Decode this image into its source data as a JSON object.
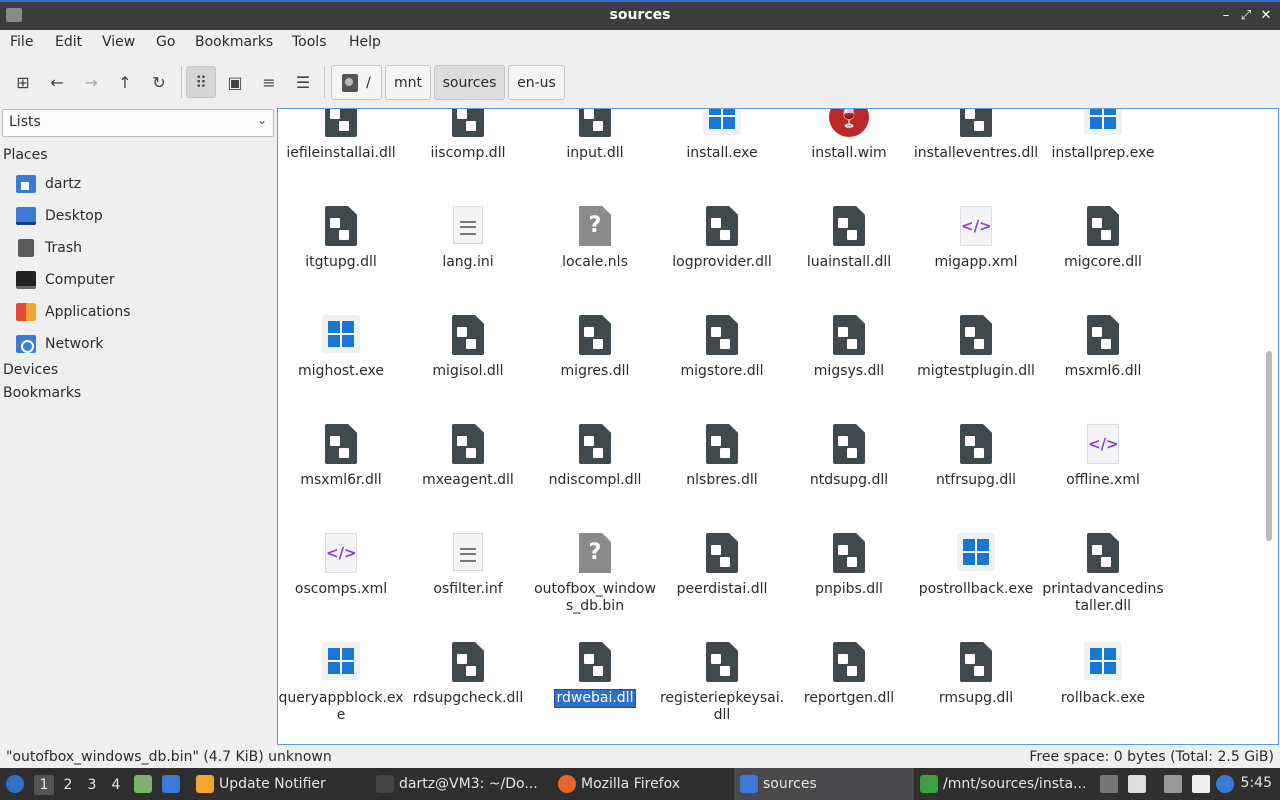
{
  "window": {
    "title": "sources"
  },
  "menu": [
    "File",
    "Edit",
    "View",
    "Go",
    "Bookmarks",
    "Tools",
    "Help"
  ],
  "path": {
    "root": "/",
    "segments": [
      "mnt",
      "sources",
      "en-us"
    ],
    "active": "sources"
  },
  "side": {
    "view_select": "Lists",
    "places_heading": "Places",
    "places": [
      {
        "label": "dartz",
        "icon": "home-folder-icon"
      },
      {
        "label": "Desktop",
        "icon": "desktop-icon"
      },
      {
        "label": "Trash",
        "icon": "trash-icon"
      },
      {
        "label": "Computer",
        "icon": "computer-icon"
      },
      {
        "label": "Applications",
        "icon": "applications-icon"
      },
      {
        "label": "Network",
        "icon": "network-icon"
      }
    ],
    "devices_heading": "Devices",
    "bookmarks_heading": "Bookmarks"
  },
  "files": [
    {
      "name": "iefileinstallai.dll",
      "type": "dll"
    },
    {
      "name": "iiscomp.dll",
      "type": "dll"
    },
    {
      "name": "input.dll",
      "type": "dll"
    },
    {
      "name": "install.exe",
      "type": "exe"
    },
    {
      "name": "install.wim",
      "type": "wim"
    },
    {
      "name": "installeventres.dll",
      "type": "dll"
    },
    {
      "name": "installprep.exe",
      "type": "exe"
    },
    {
      "name": "itgtupg.dll",
      "type": "dll"
    },
    {
      "name": "lang.ini",
      "type": "txt"
    },
    {
      "name": "locale.nls",
      "type": "unk"
    },
    {
      "name": "logprovider.dll",
      "type": "dll"
    },
    {
      "name": "luainstall.dll",
      "type": "dll"
    },
    {
      "name": "migapp.xml",
      "type": "xml"
    },
    {
      "name": "migcore.dll",
      "type": "dll"
    },
    {
      "name": "mighost.exe",
      "type": "exe"
    },
    {
      "name": "migisol.dll",
      "type": "dll"
    },
    {
      "name": "migres.dll",
      "type": "dll"
    },
    {
      "name": "migstore.dll",
      "type": "dll"
    },
    {
      "name": "migsys.dll",
      "type": "dll"
    },
    {
      "name": "migtestplugin.dll",
      "type": "dll"
    },
    {
      "name": "msxml6.dll",
      "type": "dll"
    },
    {
      "name": "msxml6r.dll",
      "type": "dll"
    },
    {
      "name": "mxeagent.dll",
      "type": "dll"
    },
    {
      "name": "ndiscompl.dll",
      "type": "dll"
    },
    {
      "name": "nlsbres.dll",
      "type": "dll"
    },
    {
      "name": "ntdsupg.dll",
      "type": "dll"
    },
    {
      "name": "ntfrsupg.dll",
      "type": "dll"
    },
    {
      "name": "offline.xml",
      "type": "xml"
    },
    {
      "name": "oscomps.xml",
      "type": "xml"
    },
    {
      "name": "osfilter.inf",
      "type": "txt"
    },
    {
      "name": "outofbox_windows_db.bin",
      "type": "unk"
    },
    {
      "name": "peerdistai.dll",
      "type": "dll"
    },
    {
      "name": "pnpibs.dll",
      "type": "dll"
    },
    {
      "name": "postrollback.exe",
      "type": "exe"
    },
    {
      "name": "printadvancedinstaller.dll",
      "type": "dll"
    },
    {
      "name": "queryappblock.exe",
      "type": "exe"
    },
    {
      "name": "rdsupgcheck.dll",
      "type": "dll"
    },
    {
      "name": "rdwebai.dll",
      "type": "dll",
      "selected": true
    },
    {
      "name": "registeriepkeysai.dll",
      "type": "dll"
    },
    {
      "name": "reportgen.dll",
      "type": "dll"
    },
    {
      "name": "rmsupg.dll",
      "type": "dll"
    },
    {
      "name": "rollback.exe",
      "type": "exe"
    }
  ],
  "status": {
    "left": "\"outofbox_windows_db.bin\" (4.7 KiB) unknown",
    "right": "Free space: 0 bytes (Total: 2.5 GiB)"
  },
  "taskbar": {
    "workspaces": [
      "1",
      "2",
      "3",
      "4"
    ],
    "tasks": [
      {
        "label": "Update Notifier",
        "color": "#f0a630"
      },
      {
        "label": "dartz@VM3: ~/Do...",
        "color": "#444444"
      },
      {
        "label": "Mozilla Firefox",
        "color": "#e8662a"
      },
      {
        "label": "sources",
        "color": "#3b7ad6"
      },
      {
        "label": "/mnt/sources/insta...",
        "color": "#3fa040"
      }
    ],
    "clock": "5:45"
  }
}
